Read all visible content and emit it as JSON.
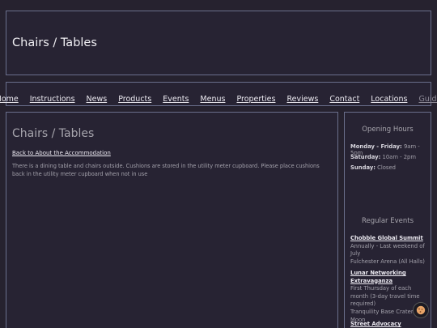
{
  "header": {
    "title": "Chairs / Tables"
  },
  "nav": {
    "items": [
      {
        "label": "Home"
      },
      {
        "label": "Instructions"
      },
      {
        "label": "News"
      },
      {
        "label": "Products"
      },
      {
        "label": "Events"
      },
      {
        "label": "Menus"
      },
      {
        "label": "Properties"
      },
      {
        "label": "Reviews"
      },
      {
        "label": "Contact"
      },
      {
        "label": "Locations"
      },
      {
        "label": "Guide"
      }
    ]
  },
  "main": {
    "heading": "Chairs / Tables",
    "back_link": "Back to About the Accommodation",
    "body": "There is a dining table and chairs outside. Cushions are stored in the utility meter cupboard. Please place cushions back in the utility meter cupboard when not in use"
  },
  "sidebar": {
    "hours_title": "Opening Hours",
    "hours": [
      {
        "day": "Monday - Friday:",
        "time": "9am - 5pm"
      },
      {
        "day": "Saturday:",
        "time": "10am - 2pm"
      },
      {
        "day": "Sunday:",
        "time": "Closed"
      }
    ],
    "events_title": "Regular Events",
    "events": [
      {
        "name": "Chobble Global Summit",
        "info": "Annually - Last weekend of July",
        "place": "Fulchester Arena (All Halls)"
      },
      {
        "name": "Lunar Networking Extravaganza",
        "info": "First Thursday of each month (3-day travel time required)",
        "place": "Tranquility Base Crater, The Moon"
      },
      {
        "name": "Street Advocacy Sessions",
        "info": "",
        "place": ""
      }
    ]
  },
  "icons": {
    "cookie": "cookie-icon"
  }
}
